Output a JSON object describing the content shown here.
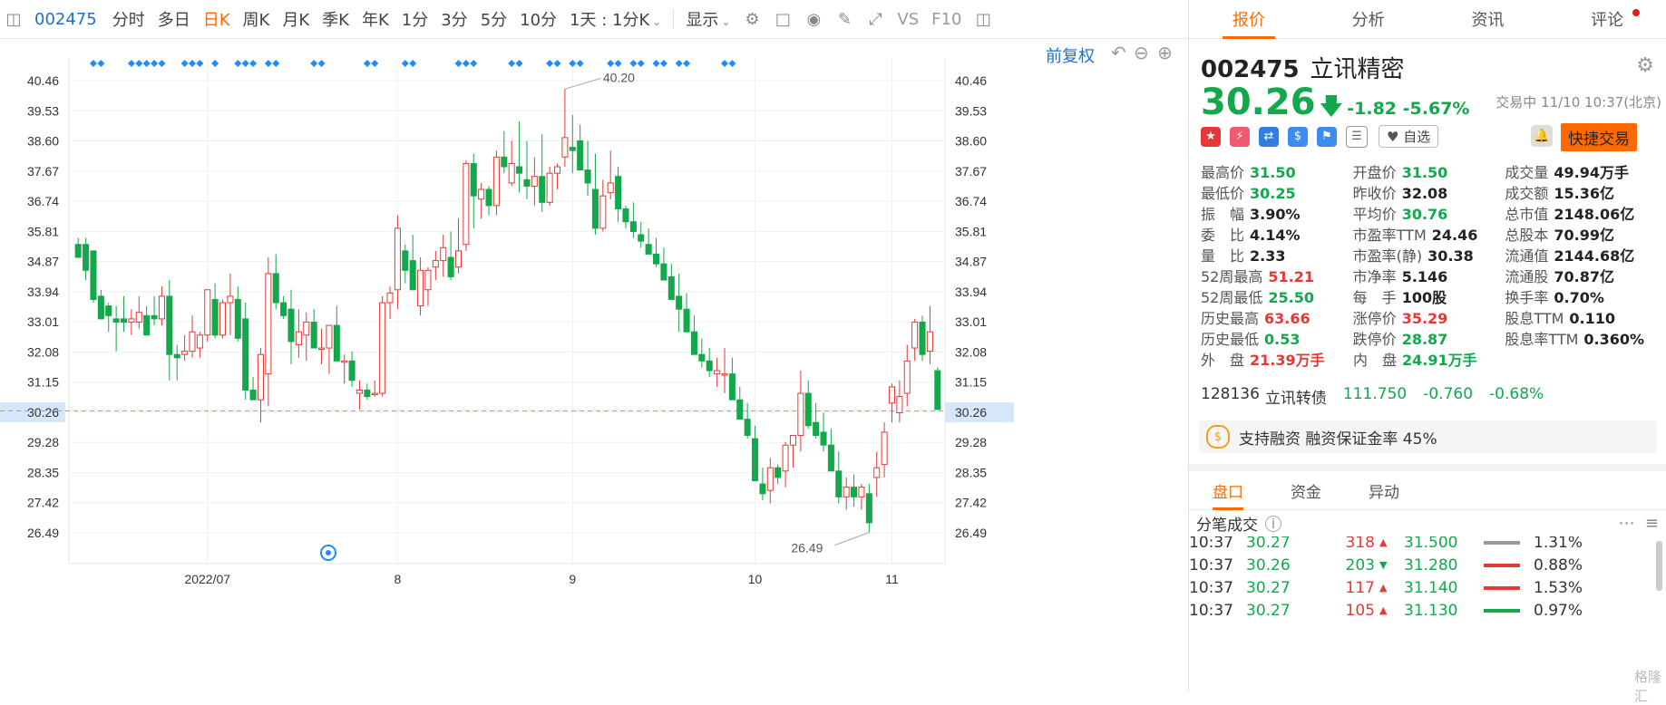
{
  "toolbar": {
    "code": "002475",
    "periods": [
      "分时",
      "多日",
      "日K",
      "周K",
      "月K",
      "季K",
      "年K",
      "1分",
      "3分",
      "5分",
      "10分"
    ],
    "active_period": "日K",
    "range": "1天 : 1分K",
    "display": "显示",
    "vs_label": "VS",
    "f10_label": "F10"
  },
  "chart_controls": {
    "restore": "前复权"
  },
  "chart_data": {
    "type": "candlestick",
    "y_ticks": [
      "40.46",
      "39.53",
      "38.60",
      "37.67",
      "36.74",
      "35.81",
      "34.87",
      "33.94",
      "33.01",
      "32.08",
      "31.15",
      "30.26",
      "29.28",
      "28.35",
      "27.42",
      "26.49"
    ],
    "y_range": [
      26.49,
      40.46
    ],
    "x_labels": [
      "2022/07",
      "8",
      "9",
      "10",
      "11"
    ],
    "current_price": "30.26",
    "high_annotation": "40.20",
    "low_annotation": "26.49",
    "up_color": "#e53935",
    "down_color": "#12a84b",
    "candles": [
      [
        35.4,
        35.6,
        35.0,
        35.0
      ],
      [
        35.4,
        35.6,
        34.3,
        34.6
      ],
      [
        35.2,
        35.2,
        33.6,
        33.7
      ],
      [
        33.8,
        34.0,
        33.3,
        33.1
      ],
      [
        33.5,
        33.6,
        32.7,
        33.2
      ],
      [
        33.1,
        33.5,
        32.1,
        33.0
      ],
      [
        33.1,
        33.8,
        32.7,
        33.0
      ],
      [
        33.0,
        33.4,
        32.6,
        33.1
      ],
      [
        33.0,
        33.8,
        32.8,
        33.3
      ],
      [
        33.2,
        33.5,
        32.9,
        32.6
      ],
      [
        33.2,
        33.8,
        32.9,
        33.1
      ],
      [
        33.1,
        34.1,
        32.9,
        33.8
      ],
      [
        33.8,
        34.3,
        31.2,
        32.0
      ],
      [
        32.0,
        32.3,
        31.2,
        31.9
      ],
      [
        32.0,
        32.6,
        31.8,
        32.1
      ],
      [
        32.1,
        33.2,
        31.9,
        32.7
      ],
      [
        32.2,
        32.7,
        31.9,
        32.6
      ],
      [
        32.6,
        34.0,
        32.4,
        34.0
      ],
      [
        33.7,
        34.2,
        32.5,
        32.6
      ],
      [
        32.6,
        33.7,
        32.5,
        33.6
      ],
      [
        33.6,
        34.5,
        32.6,
        33.8
      ],
      [
        33.7,
        34.1,
        32.4,
        32.5
      ],
      [
        33.1,
        33.6,
        30.6,
        30.9
      ],
      [
        30.9,
        31.3,
        30.6,
        30.6
      ],
      [
        30.6,
        32.2,
        29.9,
        32.0
      ],
      [
        31.4,
        35.0,
        30.4,
        34.5
      ],
      [
        34.5,
        35.1,
        33.4,
        33.6
      ],
      [
        33.6,
        33.8,
        33.1,
        33.2
      ],
      [
        33.4,
        34.0,
        31.7,
        32.4
      ],
      [
        32.3,
        33.4,
        31.9,
        32.7
      ],
      [
        32.6,
        33.3,
        31.8,
        33.0
      ],
      [
        33.0,
        33.4,
        32.6,
        32.2
      ],
      [
        32.2,
        32.8,
        31.7,
        32.2
      ],
      [
        32.2,
        32.6,
        31.4,
        32.9
      ],
      [
        32.9,
        33.5,
        32.3,
        31.8
      ],
      [
        31.8,
        32.0,
        31.1,
        31.8
      ],
      [
        31.8,
        32.1,
        31.0,
        31.2
      ],
      [
        30.8,
        31.2,
        30.3,
        30.9
      ],
      [
        30.9,
        31.1,
        30.6,
        30.7
      ],
      [
        30.8,
        31.2,
        30.7,
        30.8
      ],
      [
        30.8,
        33.8,
        30.7,
        33.6
      ],
      [
        33.6,
        34.1,
        33.1,
        33.9
      ],
      [
        34.0,
        36.3,
        33.4,
        35.9
      ],
      [
        35.2,
        35.4,
        34.2,
        34.6
      ],
      [
        34.9,
        35.7,
        34.4,
        34.0
      ],
      [
        33.5,
        35.0,
        33.2,
        34.6
      ],
      [
        34.0,
        34.7,
        33.5,
        34.6
      ],
      [
        34.7,
        35.2,
        34.3,
        34.9
      ],
      [
        34.9,
        35.7,
        34.4,
        35.3
      ],
      [
        35.0,
        35.8,
        34.3,
        34.4
      ],
      [
        34.7,
        36.2,
        34.5,
        35.2
      ],
      [
        35.4,
        38.0,
        35.2,
        37.9
      ],
      [
        37.9,
        38.2,
        35.9,
        36.9
      ],
      [
        36.8,
        37.3,
        36.2,
        37.1
      ],
      [
        37.1,
        37.2,
        36.3,
        36.6
      ],
      [
        36.6,
        38.3,
        36.3,
        38.1
      ],
      [
        38.1,
        38.9,
        37.6,
        37.8
      ],
      [
        37.3,
        38.6,
        37.2,
        37.9
      ],
      [
        37.8,
        39.2,
        37.0,
        37.6
      ],
      [
        37.4,
        38.6,
        36.8,
        37.2
      ],
      [
        37.2,
        38.1,
        36.6,
        37.5
      ],
      [
        37.5,
        38.8,
        36.4,
        36.7
      ],
      [
        36.7,
        37.8,
        36.6,
        37.6
      ],
      [
        37.6,
        37.9,
        37.1,
        37.8
      ],
      [
        38.1,
        40.2,
        37.8,
        38.7
      ],
      [
        38.4,
        39.4,
        37.6,
        38.3
      ],
      [
        38.6,
        39.1,
        37.9,
        37.7
      ],
      [
        37.7,
        38.6,
        36.9,
        37.3
      ],
      [
        37.1,
        38.2,
        35.7,
        35.9
      ],
      [
        35.9,
        37.4,
        35.8,
        36.9
      ],
      [
        37.0,
        38.3,
        36.8,
        37.3
      ],
      [
        37.5,
        37.8,
        36.1,
        36.5
      ],
      [
        36.5,
        36.6,
        35.9,
        36.1
      ],
      [
        36.1,
        36.7,
        35.6,
        35.8
      ],
      [
        35.7,
        36.1,
        35.3,
        35.5
      ],
      [
        35.4,
        35.9,
        35.1,
        35.1
      ],
      [
        35.1,
        35.6,
        34.7,
        34.8
      ],
      [
        34.8,
        35.3,
        34.4,
        34.3
      ],
      [
        34.4,
        34.8,
        33.7,
        33.7
      ],
      [
        33.8,
        34.5,
        32.7,
        33.4
      ],
      [
        33.4,
        33.9,
        32.8,
        32.7
      ],
      [
        32.7,
        33.2,
        32.4,
        32.0
      ],
      [
        32.0,
        32.5,
        31.6,
        31.8
      ],
      [
        31.8,
        32.2,
        31.3,
        31.5
      ],
      [
        31.4,
        31.9,
        31.0,
        31.5
      ],
      [
        31.4,
        32.2,
        30.8,
        31.4
      ],
      [
        31.4,
        31.9,
        31.0,
        30.6
      ],
      [
        30.6,
        31.0,
        30.2,
        30.0
      ],
      [
        30.0,
        30.5,
        29.4,
        29.5
      ],
      [
        29.4,
        29.8,
        28.1,
        28.1
      ],
      [
        28.0,
        28.5,
        27.5,
        27.7
      ],
      [
        27.8,
        28.8,
        27.4,
        28.5
      ],
      [
        28.5,
        28.6,
        28.0,
        28.2
      ],
      [
        28.4,
        29.3,
        27.9,
        29.2
      ],
      [
        29.2,
        29.5,
        28.5,
        29.5
      ],
      [
        29.5,
        31.5,
        29.0,
        30.8
      ],
      [
        30.8,
        31.2,
        29.7,
        29.8
      ],
      [
        29.9,
        30.5,
        29.4,
        29.5
      ],
      [
        29.6,
        30.2,
        29.0,
        29.2
      ],
      [
        29.2,
        29.7,
        28.6,
        28.4
      ],
      [
        28.4,
        29.0,
        27.4,
        27.6
      ],
      [
        27.6,
        28.2,
        27.2,
        27.9
      ],
      [
        27.9,
        28.3,
        27.3,
        27.6
      ],
      [
        27.6,
        28.0,
        27.2,
        27.9
      ],
      [
        27.7,
        28.0,
        26.5,
        26.8
      ],
      [
        28.2,
        29.0,
        27.6,
        28.5
      ],
      [
        28.6,
        29.9,
        28.2,
        29.6
      ],
      [
        30.5,
        31.1,
        29.9,
        31.0
      ],
      [
        30.2,
        31.2,
        29.9,
        30.7
      ],
      [
        30.8,
        32.3,
        30.4,
        31.8
      ],
      [
        32.2,
        33.1,
        31.8,
        33.0
      ],
      [
        33.0,
        33.2,
        31.8,
        32.0
      ],
      [
        32.1,
        33.5,
        31.7,
        32.7
      ],
      [
        31.5,
        31.6,
        30.3,
        30.3
      ]
    ],
    "events": [
      2,
      3,
      7,
      8,
      9,
      10,
      11,
      14,
      15,
      16,
      18,
      21,
      22,
      23,
      25,
      26,
      31,
      32,
      38,
      39,
      43,
      44,
      50,
      51,
      52,
      57,
      58,
      62,
      63,
      65,
      66,
      70,
      71,
      73,
      74,
      76,
      77,
      79,
      80,
      85,
      86
    ]
  },
  "panel": {
    "tabs": [
      "报价",
      "分析",
      "资讯",
      "评论"
    ],
    "active_tab": "报价",
    "code": "002475",
    "name": "立讯精密",
    "price": "30.26",
    "change": "-1.82",
    "change_pct": "-5.67%",
    "status": "交易中 11/10 10:37(北京)",
    "watch_label": "自选",
    "quick_trade": "快捷交易",
    "stats": [
      [
        {
          "k": "最高价",
          "v": "31.50",
          "c": "green"
        },
        {
          "k": "开盘价",
          "v": "31.50",
          "c": "green"
        },
        {
          "k": "成交量",
          "v": "49.94万手",
          "c": "blk"
        }
      ],
      [
        {
          "k": "最低价",
          "v": "30.25",
          "c": "green"
        },
        {
          "k": "昨收价",
          "v": "32.08",
          "c": "blk"
        },
        {
          "k": "成交额",
          "v": "15.36亿",
          "c": "blk"
        }
      ],
      [
        {
          "k": "振　幅",
          "v": "3.90%",
          "c": "blk"
        },
        {
          "k": "平均价",
          "v": "30.76",
          "c": "green"
        },
        {
          "k": "总市值",
          "v": "2148.06亿",
          "c": "blk"
        }
      ],
      [
        {
          "k": "委　比",
          "v": "4.14%",
          "c": "blk"
        },
        {
          "k": "市盈率TTM",
          "v": "24.46",
          "c": "blk"
        },
        {
          "k": "总股本",
          "v": "70.99亿",
          "c": "blk"
        }
      ],
      [
        {
          "k": "量　比",
          "v": "2.33",
          "c": "blk"
        },
        {
          "k": "市盈率(静)",
          "v": "30.38",
          "c": "blk"
        },
        {
          "k": "流通值",
          "v": "2144.68亿",
          "c": "blk"
        }
      ],
      [
        {
          "k": "52周最高",
          "v": "51.21",
          "c": "red"
        },
        {
          "k": "市净率",
          "v": "5.146",
          "c": "blk"
        },
        {
          "k": "流通股",
          "v": "70.87亿",
          "c": "blk"
        }
      ],
      [
        {
          "k": "52周最低",
          "v": "25.50",
          "c": "green"
        },
        {
          "k": "每　手",
          "v": "100股",
          "c": "blk"
        },
        {
          "k": "换手率",
          "v": "0.70%",
          "c": "blk"
        }
      ],
      [
        {
          "k": "历史最高",
          "v": "63.66",
          "c": "red"
        },
        {
          "k": "涨停价",
          "v": "35.29",
          "c": "red"
        },
        {
          "k": "股息TTM",
          "v": "0.110",
          "c": "blk"
        }
      ],
      [
        {
          "k": "历史最低",
          "v": "0.53",
          "c": "green"
        },
        {
          "k": "跌停价",
          "v": "28.87",
          "c": "green"
        },
        {
          "k": "股息率TTM",
          "v": "0.360%",
          "c": "blk"
        }
      ],
      [
        {
          "k": "外　盘",
          "v": "21.39万手",
          "c": "red"
        },
        {
          "k": "内　盘",
          "v": "24.91万手",
          "c": "green"
        }
      ]
    ],
    "convertible": {
      "code": "128136",
      "name": "立讯转债",
      "price": "111.750",
      "change": "-0.760",
      "pct": "-0.68%"
    },
    "margin_text": "支持融资 融资保证金率 45%",
    "subtabs": [
      "盘口",
      "资金",
      "异动"
    ],
    "active_subtab": "盘口",
    "trades_title": "分笔成交",
    "trades": [
      {
        "t": "10:37",
        "p": "30.27",
        "v": "318",
        "dir": "up",
        "bp": "31.500",
        "pct": "1.31%",
        "bar": "#999"
      },
      {
        "t": "10:37",
        "p": "30.26",
        "v": "203",
        "dir": "down",
        "bp": "31.280",
        "pct": "0.88%",
        "bar": "#e53935"
      },
      {
        "t": "10:37",
        "p": "30.27",
        "v": "117",
        "dir": "up",
        "bp": "31.140",
        "pct": "1.53%",
        "bar": "#e53935"
      },
      {
        "t": "10:37",
        "p": "30.27",
        "v": "105",
        "dir": "up",
        "bp": "31.130",
        "pct": "0.97%",
        "bar": "#12a84b"
      }
    ],
    "watermark": "格隆汇"
  }
}
